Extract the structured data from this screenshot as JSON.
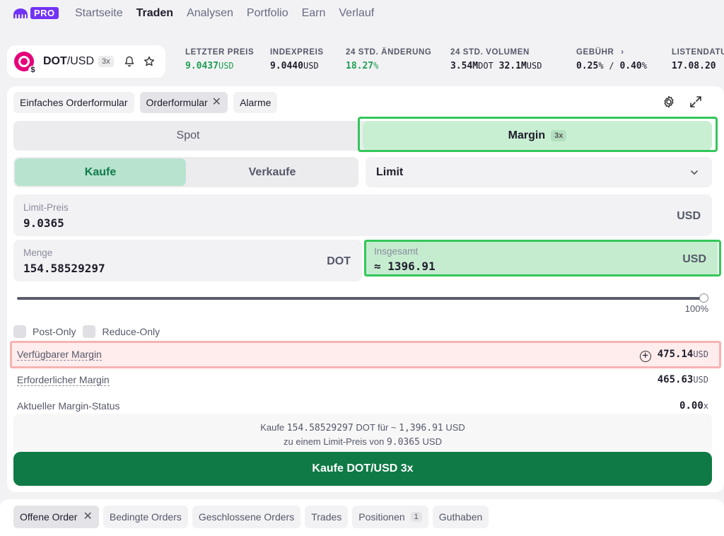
{
  "brand": {
    "pro_label": "PRO"
  },
  "nav": [
    "Startseite",
    "Traden",
    "Analysen",
    "Portfolio",
    "Earn",
    "Verlauf"
  ],
  "pair": {
    "base": "DOT",
    "quote": "/USD",
    "leverage": "3x"
  },
  "stats": {
    "last_price": {
      "label": "LETZTER PREIS",
      "value": "9.0437",
      "unit": "USD"
    },
    "index_price": {
      "label": "INDEXPREIS",
      "value": "9.0440",
      "unit": "USD"
    },
    "change_24h": {
      "label": "24 STD. ÄNDERUNG",
      "value": "18.27",
      "unit": "%"
    },
    "volume_24h": {
      "label": "24 STD. VOLUMEN",
      "value1": "3.54M",
      "unit1": "DOT",
      "value2": "32.1M",
      "unit2": "USD"
    },
    "fee": {
      "label": "GEBÜHR",
      "maker": "0.25",
      "taker": "0.40"
    },
    "listing": {
      "label": "LISTENDATUM",
      "value": "17.08.20"
    }
  },
  "tabs": {
    "simple": "Einfaches Orderformular",
    "order": "Orderformular",
    "alerts": "Alarme"
  },
  "mode": {
    "spot": "Spot",
    "margin": "Margin",
    "margin_badge": "3x"
  },
  "side": {
    "buy": "Kaufe",
    "sell": "Verkaufe"
  },
  "order_type": "Limit",
  "limit_price": {
    "label": "Limit-Preis",
    "value": "9.0365",
    "unit": "USD"
  },
  "quantity": {
    "label": "Menge",
    "value": "154.58529297",
    "unit": "DOT"
  },
  "total": {
    "label": "Insgesamt",
    "value": "≈ 1396.91",
    "unit": "USD"
  },
  "slider": {
    "percent_label": "100%",
    "value": 1.0
  },
  "options": {
    "post_only": "Post-Only",
    "reduce_only": "Reduce-Only"
  },
  "margin_info": {
    "available": {
      "label": "Verfügbarer Margin",
      "value": "475.14",
      "unit": "USD"
    },
    "required": {
      "label": "Erforderlicher Margin",
      "value": "465.63",
      "unit": "USD"
    },
    "status": {
      "label": "Aktueller Margin-Status",
      "value": "0.00",
      "unit": "x"
    }
  },
  "summary": {
    "line1_prefix": "Kaufe ",
    "line1_qty": "154.58529297",
    "line1_mid": " DOT für ~ ",
    "line1_total": "1,396.91",
    "line1_suffix": " USD",
    "line2_prefix": "zu einem Limit-Preis von ",
    "line2_price": "9.0365",
    "line2_suffix": " USD"
  },
  "submit_label": "Kaufe DOT/USD 3x",
  "bottom_tabs": {
    "open": "Offene Order",
    "conditional": "Bedingte Orders",
    "closed": "Geschlossene Orders",
    "trades": "Trades",
    "positions": "Positionen",
    "positions_count": "1",
    "balances": "Guthaben"
  },
  "colors": {
    "accent": "#7132f5",
    "buy": "#0f7a45",
    "positive": "#1f9d55",
    "highlight_green": "#34c759",
    "highlight_red": "#f6b3b3"
  }
}
